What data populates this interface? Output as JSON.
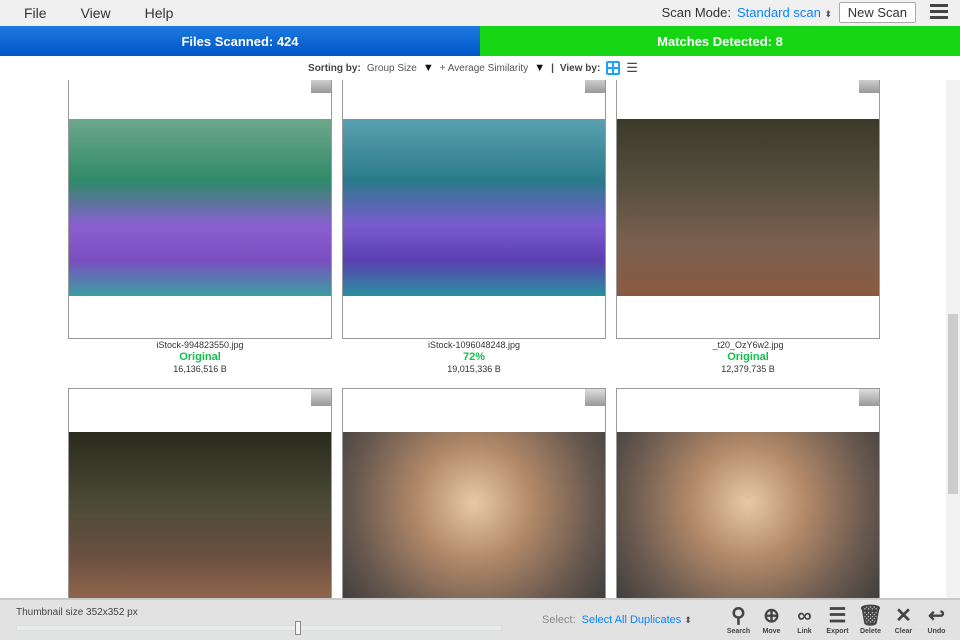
{
  "menu": {
    "file": "File",
    "view": "View",
    "help": "Help"
  },
  "header": {
    "scan_mode_label": "Scan Mode:",
    "scan_mode_value": "Standard scan",
    "new_scan": "New Scan"
  },
  "stats": {
    "files_scanned": "Files Scanned: 424",
    "matches": "Matches Detected: 8"
  },
  "sortbar": {
    "sorting_label": "Sorting by:",
    "sort1": "Group Size",
    "sort2": "+ Average Similarity",
    "view_label": "View by:"
  },
  "items": [
    {
      "name": "iStock-994823550.jpg",
      "status": "Original",
      "size": "16,136,516 B"
    },
    {
      "name": "iStock-1096048248.jpg",
      "status": "72%",
      "size": "19,015,336 B"
    },
    {
      "name": "_t20_OzY6w2.jpg",
      "status": "Original",
      "size": "12,379,735 B"
    }
  ],
  "bottom": {
    "thumb_size": "Thumbnail size 352x352 px",
    "select_label": "Select:",
    "select_value": "Select All Duplicates",
    "slider_value": 0.58,
    "tools": [
      "Search",
      "Move",
      "Link",
      "Export",
      "Delete",
      "Clear",
      "Undo"
    ]
  },
  "colors": {
    "accent": "#0a84ff",
    "blue": "#0055c8",
    "green": "#15d515",
    "original": "#12c04a"
  }
}
